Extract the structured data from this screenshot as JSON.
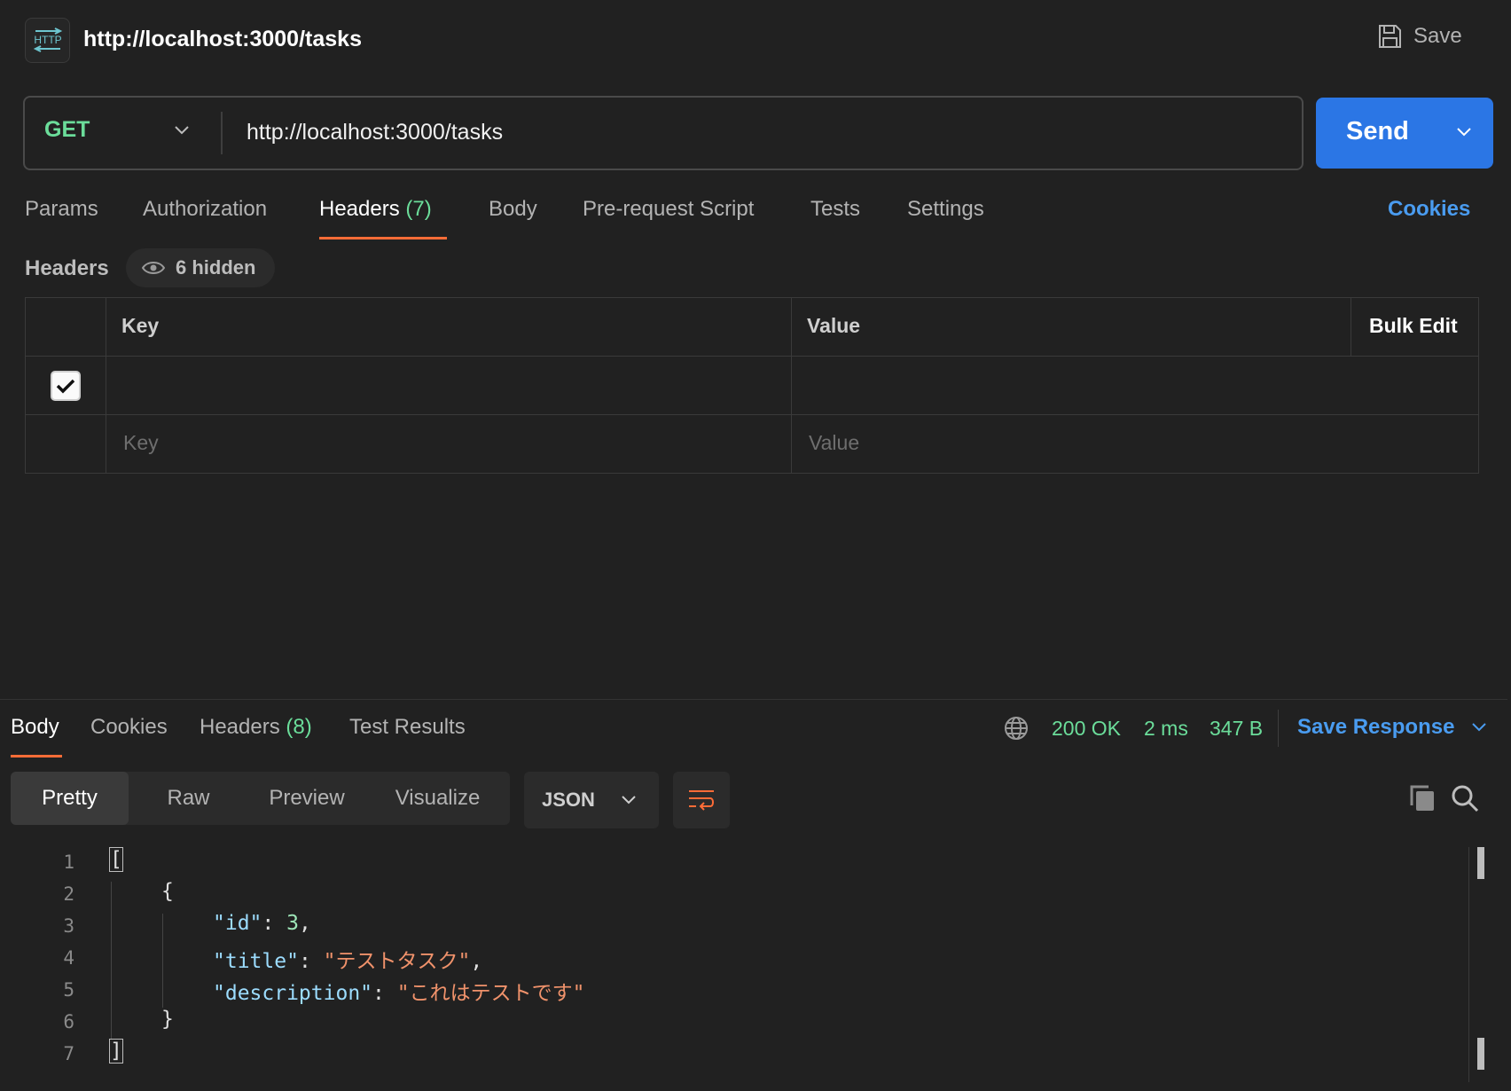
{
  "header": {
    "title": "http://localhost:3000/tasks",
    "badge": "HTTP",
    "save_label": "Save"
  },
  "request": {
    "method": "GET",
    "url": "http://localhost:3000/tasks",
    "send_label": "Send"
  },
  "request_tabs": [
    {
      "label": "Params"
    },
    {
      "label": "Authorization"
    },
    {
      "label": "Headers",
      "count": "(7)"
    },
    {
      "label": "Body"
    },
    {
      "label": "Pre-request Script"
    },
    {
      "label": "Tests"
    },
    {
      "label": "Settings"
    }
  ],
  "cookies_label": "Cookies",
  "headers_section": {
    "label": "Headers",
    "hidden_label": "6 hidden",
    "columns": {
      "key": "Key",
      "value": "Value",
      "bulk_edit": "Bulk Edit"
    },
    "placeholder": {
      "key": "Key",
      "value": "Value"
    }
  },
  "response": {
    "tabs": [
      {
        "label": "Body"
      },
      {
        "label": "Cookies"
      },
      {
        "label": "Headers",
        "count": "(8)"
      },
      {
        "label": "Test Results"
      }
    ],
    "status": "200 OK",
    "time": "2 ms",
    "size": "347 B",
    "save_response_label": "Save Response",
    "views": [
      "Pretty",
      "Raw",
      "Preview",
      "Visualize"
    ],
    "format": "JSON",
    "line_numbers": [
      "1",
      "2",
      "3",
      "4",
      "5",
      "6",
      "7"
    ],
    "code": {
      "open_bracket": "[",
      "open_brace": "{",
      "id_key": "\"id\"",
      "id_value": "3",
      "title_key": "\"title\"",
      "title_value": "\"テストタスク\"",
      "desc_key": "\"description\"",
      "desc_value": "\"これはテストです\"",
      "close_brace": "}",
      "close_bracket": "]"
    }
  },
  "colors": {
    "accent": "#ff6c37",
    "send": "#2b76e5",
    "method_get": "#6bdd9a",
    "link": "#4a9cf0"
  }
}
